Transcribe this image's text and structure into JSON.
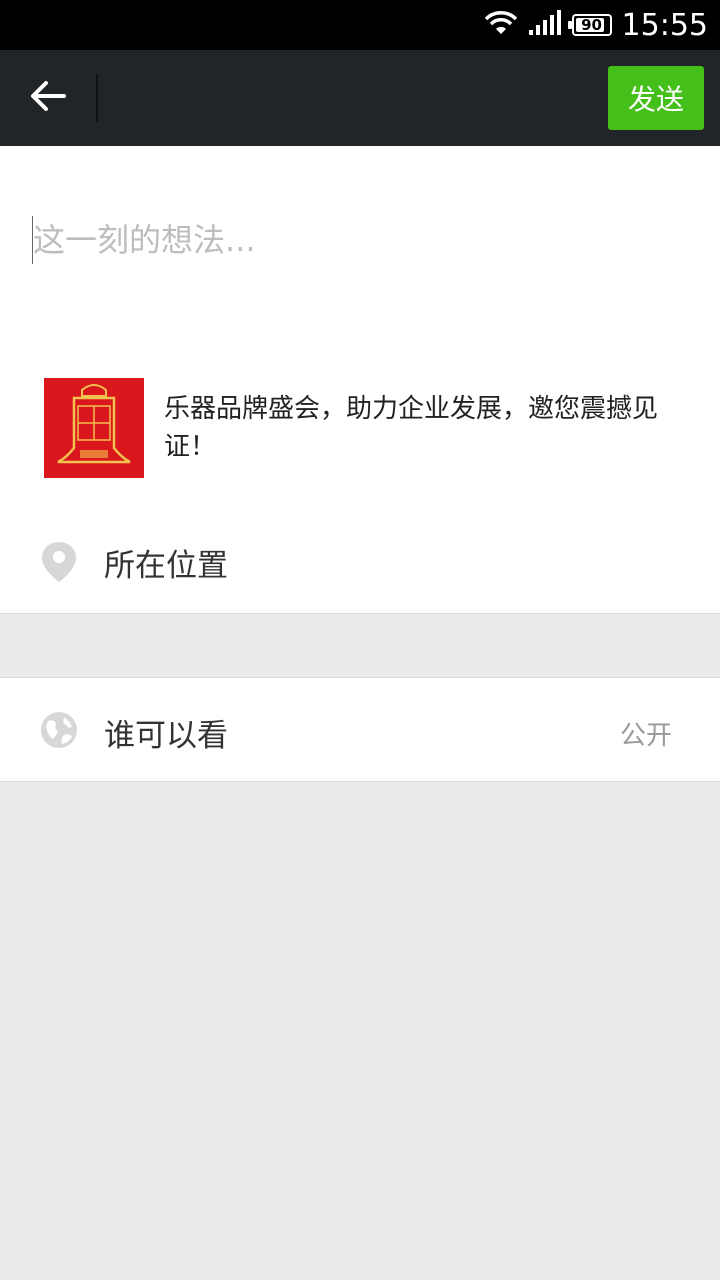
{
  "status_bar": {
    "time": "15:55",
    "battery": "90",
    "battery_level": 0.9,
    "wifi_icon": "wifi-icon",
    "signal_icon": "signal-icon"
  },
  "toolbar": {
    "back_icon": "back-arrow-icon",
    "send_label": "发送",
    "send_color": "#45c01a"
  },
  "compose": {
    "placeholder": "这一刻的想法...",
    "value": ""
  },
  "share_card": {
    "title": "乐器品牌盛会，助力企业发展，邀您震撼见证！",
    "thumbnail_icon": "event-logo-thumbnail"
  },
  "location": {
    "icon": "location-pin-icon",
    "label": "所在位置"
  },
  "visibility": {
    "icon": "globe-icon",
    "label": "谁可以看",
    "value": "公开"
  }
}
